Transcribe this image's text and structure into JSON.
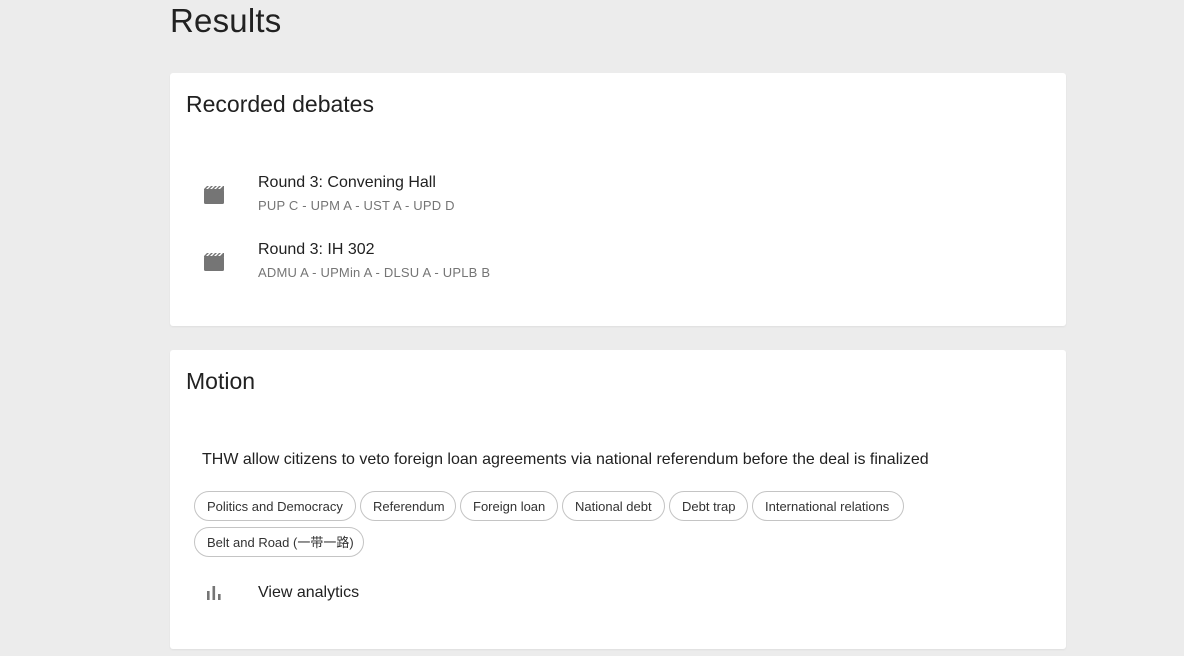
{
  "page": {
    "title": "Results"
  },
  "debates_card": {
    "title": "Recorded debates",
    "items": [
      {
        "icon": "movie-clapperboard-icon",
        "title": "Round 3: Convening Hall",
        "teams": "PUP C - UPM A - UST A - UPD D"
      },
      {
        "icon": "movie-clapperboard-icon",
        "title": "Round 3: IH 302",
        "teams": "ADMU A - UPMin A - DLSU A - UPLB B"
      }
    ]
  },
  "motion_card": {
    "title": "Motion",
    "motion_text": "THW allow citizens to veto foreign loan agreements via national referendum before the deal is finalized",
    "tags": [
      "Politics and Democracy",
      "Referendum",
      "Foreign loan",
      "National debt",
      "Debt trap",
      "International relations",
      "Belt and Road (一带一路)"
    ],
    "analytics_icon": "bar-chart-icon",
    "analytics_label": "View analytics"
  },
  "colors": {
    "background": "#ececec",
    "card": "#ffffff",
    "text_primary": "#212121",
    "text_secondary": "#757575",
    "icon": "#757575",
    "chip_border": "#c4c4c4"
  }
}
